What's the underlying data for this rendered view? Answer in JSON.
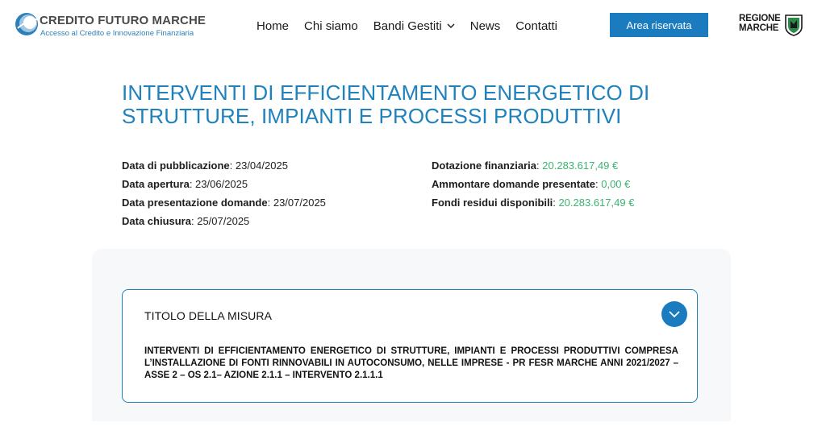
{
  "header": {
    "logo": {
      "title": "CREDITO FUTURO MARCHE",
      "subtitle": "Accesso al Credito e Innovazione Finanziaria",
      "icon": "globe-logo-icon"
    },
    "nav": [
      {
        "label": "Home"
      },
      {
        "label": "Chi siamo"
      },
      {
        "label": "Bandi Gestiti",
        "icon": "chevron-down-icon"
      },
      {
        "label": "News"
      },
      {
        "label": "Contatti"
      }
    ],
    "area_button": "Area riservata",
    "regione": {
      "line1": "REGIONE",
      "line2": "MARCHE",
      "icon": "regione-marche-shield-icon"
    }
  },
  "page": {
    "title": "INTERVENTI DI EFFICIENTAMENTO ENERGETICO DI STRUTTURE, IMPIANTI E PROCESSI PRODUTTIVI"
  },
  "meta": {
    "left": [
      {
        "label": "Data di pubblicazione",
        "value": "23/04/2025"
      },
      {
        "label": "Data apertura",
        "value": "23/06/2025"
      },
      {
        "label": "Data presentazione domande",
        "value": "23/07/2025"
      },
      {
        "label": "Data chiusura",
        "value": "25/07/2025"
      }
    ],
    "right": [
      {
        "label": "Dotazione finanziaria",
        "value": "20.283.617,49 €"
      },
      {
        "label": "Ammontare domande presentate",
        "value": "0,00 €"
      },
      {
        "label": "Fondi residui disponibili",
        "value": "20.283.617,49 €"
      }
    ]
  },
  "accordion": {
    "title": "TITOLO DELLA MISURA",
    "toggle_icon": "chevron-down-icon",
    "body": "INTERVENTI DI EFFICIENTAMENTO ENERGETICO DI STRUTTURE, IMPIANTI E PROCESSI PRODUTTIVI COMPRESA L’INSTALLAZIONE DI FONTI RINNOVABILI IN AUTOCONSUMO, NELLE IMPRESE - PR FESR MARCHE ANNI 2021/2027 – ASSE 2 – OS 2.1– AZIONE 2.1.1 – INTERVENTO 2.1.1.1"
  },
  "colors": {
    "accent": "#1f82bd",
    "button": "#1a7bbf",
    "money": "#3cb371",
    "panel": "#f6f8fa"
  }
}
